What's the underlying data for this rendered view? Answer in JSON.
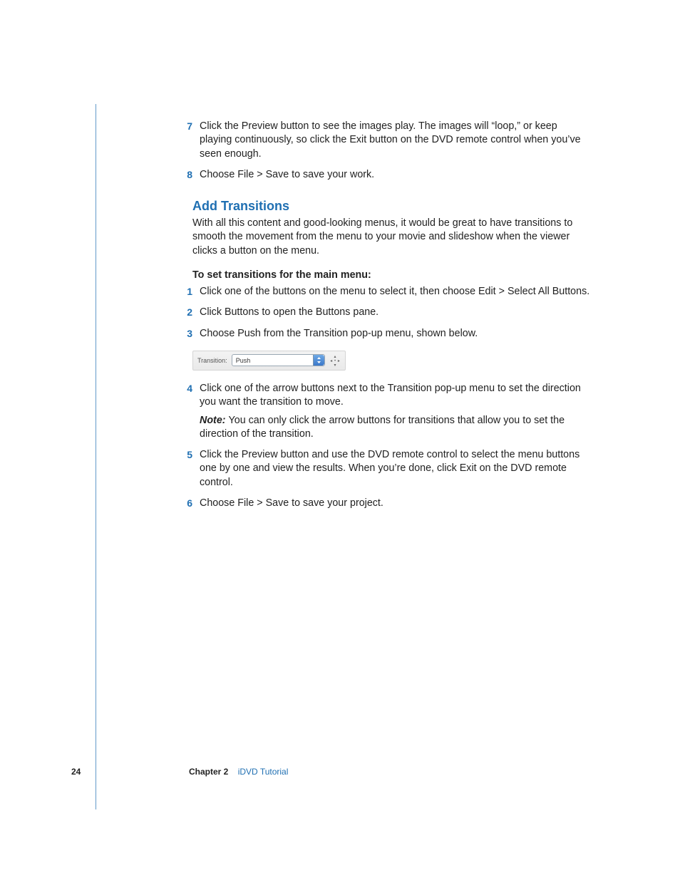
{
  "steps_top": [
    {
      "n": "7",
      "paras": [
        "Click the Preview button to see the images play. The images will “loop,” or keep playing continuously, so click the Exit button on the DVD remote control when you’ve seen enough."
      ]
    },
    {
      "n": "8",
      "paras": [
        "Choose File > Save to save your work."
      ]
    }
  ],
  "section": {
    "heading": "Add Transitions",
    "intro": "With all this content and good-looking menus, it would be great to have transitions to smooth the movement from the menu to your movie and slideshow when the viewer clicks a button on the menu.",
    "task_intro": "To set transitions for the main menu:"
  },
  "steps_main": [
    {
      "n": "1",
      "paras": [
        "Click one of the buttons on the menu to select it, then choose Edit > Select All Buttons."
      ]
    },
    {
      "n": "2",
      "paras": [
        "Click Buttons to open the Buttons pane."
      ]
    },
    {
      "n": "3",
      "paras": [
        "Choose Push from the Transition pop-up menu, shown below."
      ]
    }
  ],
  "figure": {
    "label": "Transition:",
    "value": "Push"
  },
  "steps_after": [
    {
      "n": "4",
      "paras": [
        "Click one of the arrow buttons next to the Transition pop-up menu to set the direction you want the transition to move.",
        "<note>You can only click the arrow buttons for transitions that allow you to set the direction of the transition."
      ]
    },
    {
      "n": "5",
      "paras": [
        "Click the Preview button and use the DVD remote control to select the menu buttons one by one and view the results. When you’re done, click Exit on the DVD remote control."
      ]
    },
    {
      "n": "6",
      "paras": [
        "Choose File > Save to save your project."
      ]
    }
  ],
  "note_label": "Note:  ",
  "footer": {
    "page": "24",
    "chapter_label": "Chapter 2",
    "chapter_title": "iDVD Tutorial"
  }
}
